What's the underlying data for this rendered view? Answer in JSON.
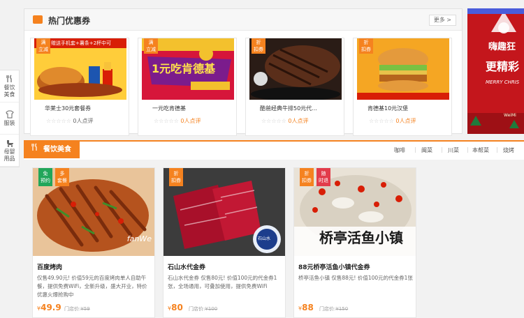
{
  "left_nav": [
    {
      "label_line1": "餐饮",
      "label_line2": "美食",
      "icon": "fork-knife-icon"
    },
    {
      "label_line1": "服装",
      "label_line2": "",
      "icon": "shirt-icon"
    },
    {
      "label_line1": "母婴",
      "label_line2": "用品",
      "icon": "stroller-icon"
    }
  ],
  "coupon_section": {
    "title": "热门优惠券",
    "more": "更多 >",
    "cards": [
      {
        "badge_line1": "满",
        "badge_line2": "立减",
        "banner": "赠送手机套+薯条+2杯中可",
        "name": "华莱士30元套餐券",
        "reviews": "0人点评"
      },
      {
        "badge_line1": "满",
        "badge_line2": "立减",
        "banner": "1元吃肯德基",
        "name": "一元吃肯德基",
        "reviews": "0人点评"
      },
      {
        "badge_line1": "折",
        "badge_line2": "扣券",
        "banner": "",
        "name": "酷爸经典牛排50元代...",
        "reviews": "0人点评"
      },
      {
        "badge_line1": "折",
        "badge_line2": "扣券",
        "banner": "",
        "name": "肯德基10元汉堡",
        "reviews": "0人点评"
      }
    ]
  },
  "promo": {
    "line1": "嗨趣狂",
    "line2": "更精彩",
    "line3": "MERRY CHRIS",
    "line4": "WeiMi"
  },
  "food_section": {
    "tab_label": "餐饮美食",
    "subnav": [
      "咖啡",
      "闽菜",
      "川菜",
      "本帮菜",
      "烧烤"
    ],
    "cards": [
      {
        "badges": [
          {
            "l1": "免",
            "l2": "预约",
            "color": "#22a65a"
          },
          {
            "l1": "多",
            "l2": "套餐",
            "color": "#f5821f"
          }
        ],
        "watermark": "fanWe",
        "title": "百度烤肉",
        "desc": "仅售49.90元! 价值59元的百度烤肉单人自助午餐，提供免费WiFi，全新升级，盛大开业，特价优惠火爆抢购中",
        "price": "49.9",
        "store_label": "门店价:",
        "store_price": "¥59"
      },
      {
        "badges": [
          {
            "l1": "折",
            "l2": "扣券",
            "color": "#f5821f"
          }
        ],
        "watermark": "石山水",
        "title": "石山水代金券",
        "desc": "石山水代金券 仅售80元! 价值100元的代金券1张，全场通用，可叠加使用，提供免费WiFi",
        "price": "80",
        "store_label": "门店价:",
        "store_price": "¥100"
      },
      {
        "badges": [
          {
            "l1": "折",
            "l2": "扣券",
            "color": "#f5821f"
          },
          {
            "l1": "随",
            "l2": "时退",
            "color": "#e23b4a"
          }
        ],
        "watermark": "桥亭活鱼小镇",
        "title": "88元桥亭活鱼小镇代金券",
        "desc": "桥亭活鱼小镇 仅售88元! 价值100元的代金券1张",
        "price": "88",
        "store_label": "门店价:",
        "store_price": "¥150"
      }
    ]
  },
  "colors": {
    "accent": "#f5821f",
    "promo_red": "#c4161c"
  }
}
